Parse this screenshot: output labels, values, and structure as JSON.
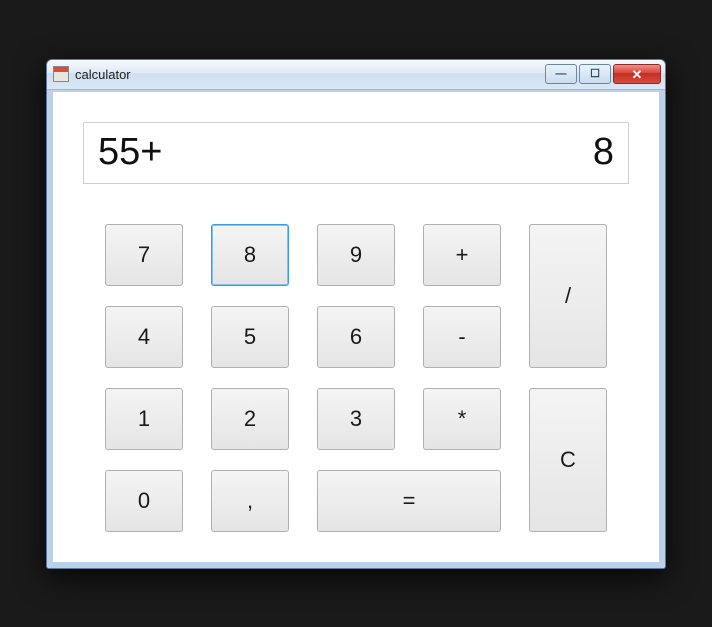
{
  "window": {
    "title": "calculator"
  },
  "display": {
    "expression": "55+",
    "current": "8"
  },
  "keys": {
    "k7": "7",
    "k8": "8",
    "k9": "9",
    "plus": "+",
    "div": "/",
    "k4": "4",
    "k5": "5",
    "k6": "6",
    "minus": "-",
    "k1": "1",
    "k2": "2",
    "k3": "3",
    "mul": "*",
    "clear": "C",
    "k0": "0",
    "comma": ",",
    "eq": "="
  }
}
